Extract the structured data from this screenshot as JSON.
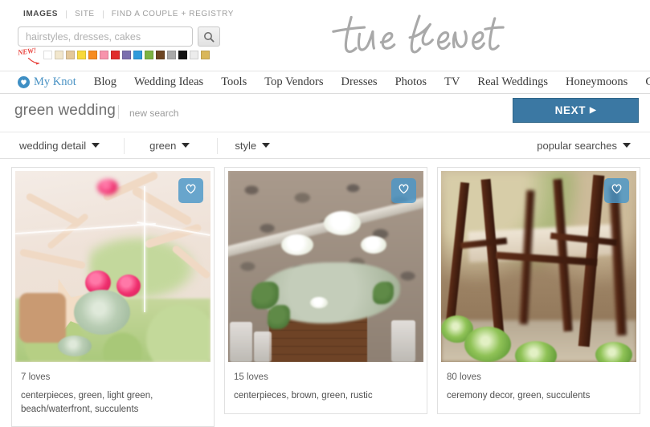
{
  "header": {
    "utility_tabs": [
      {
        "label": "IMAGES",
        "active": true
      },
      {
        "label": "SITE",
        "active": false
      },
      {
        "label": "FIND A COUPLE + REGISTRY",
        "active": false
      }
    ],
    "search": {
      "placeholder": "hairstyles, dresses, cakes",
      "value": "",
      "button_icon": "search-icon"
    },
    "new_badge": "NEW!",
    "color_swatches": [
      {
        "name": "white",
        "hex": "#ffffff"
      },
      {
        "name": "ivory",
        "hex": "#f2e7cd"
      },
      {
        "name": "tan",
        "hex": "#e4c89a"
      },
      {
        "name": "yellow",
        "hex": "#f8d93c"
      },
      {
        "name": "orange",
        "hex": "#f78b1f"
      },
      {
        "name": "pink",
        "hex": "#f793ac"
      },
      {
        "name": "red",
        "hex": "#e12d2b"
      },
      {
        "name": "purple",
        "hex": "#7b6fae"
      },
      {
        "name": "blue",
        "hex": "#2f9bdc"
      },
      {
        "name": "green",
        "hex": "#7cb342"
      },
      {
        "name": "brown",
        "hex": "#6d4522"
      },
      {
        "name": "gray",
        "hex": "#a9a9a9"
      },
      {
        "name": "black",
        "hex": "#111111"
      },
      {
        "name": "silver",
        "hex": "#ececec"
      },
      {
        "name": "gold",
        "hex": "#d9b75a"
      }
    ],
    "logo_text": "the knot"
  },
  "main_nav": {
    "my_knot": "My Knot",
    "items": [
      "Blog",
      "Wedding Ideas",
      "Tools",
      "Top Vendors",
      "Dresses",
      "Photos",
      "TV",
      "Real Weddings",
      "Honeymoons",
      "Gift Registries"
    ]
  },
  "search_results": {
    "query_title": "green wedding",
    "new_search_label": "new search",
    "next_button": "NEXT",
    "next_arrow": "▶"
  },
  "filters": {
    "wedding_detail": "wedding detail",
    "color": "green",
    "style": "style",
    "popular_searches": "popular searches"
  },
  "cards": [
    {
      "loves": "7 loves",
      "tags": "centerpieces, green, light green, beach/waterfront, succulents",
      "badge_icon": "heart-icon"
    },
    {
      "loves": "15 loves",
      "tags": "centerpieces, brown, green, rustic",
      "badge_icon": "heart-icon"
    },
    {
      "loves": "80 loves",
      "tags": "ceremony decor, green, succulents",
      "badge_icon": "heart-icon"
    }
  ],
  "colors": {
    "accent_blue": "#3b78a3",
    "badge_blue": "#4996c8",
    "link_blue": "#4a93c4",
    "new_red": "#e8403a",
    "title_gray": "#6f6f6f"
  }
}
